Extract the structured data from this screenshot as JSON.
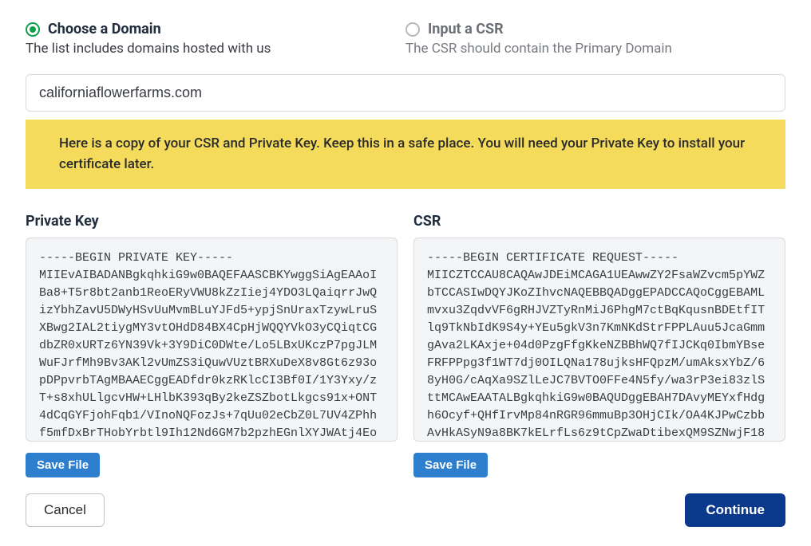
{
  "options": {
    "choose": {
      "label": "Choose a Domain",
      "sub": "The list includes domains hosted with us",
      "selected": true
    },
    "input_csr": {
      "label": "Input a CSR",
      "sub": "The CSR should contain the Primary Domain",
      "selected": false
    }
  },
  "domain": "californiaflowerfarms.com",
  "notice": "Here is a copy of your CSR and Private Key. Keep this in a safe place. You will need your Private Key to install your certificate later.",
  "private_key": {
    "label": "Private Key",
    "content": "-----BEGIN PRIVATE KEY-----\nMIIEvAIBADANBgkqhkiG9w0BAQEFAASCBKYwggSiAgEAAoI\nBa8+T5r8bt2anb1ReoERyVWU8kZzIiej4YDO3LQaiqrrJwQ\nizYbhZavU5DWyHSvUuMvmBLuYJFd5+ypjSnUraxTzywLruS\nXBwg2IAL2tiygMY3vtOHdD84BX4CpHjWQQYVkO3yCQiqtCG\ndbZR0xURTz6YN39Vk+3Y9DiC0DWte/Lo5LBxUKczP7pgJLM\nWuFJrfMh9Bv3AKl2vUmZS3iQuwVUztBRXuDeX8v8Gt6z93o\npDPpvrbTAgMBAAECggEADfdr0kzRKlcCI3Bf0I/1Y3Yxy/z\nT+s8xhULlgcvHW+LHlbK393qBy2keZSZbotLkgcs91x+ONT\n4dCqGYFjohFqb1/VInoNQFozJs+7qUu02eCbZ0L7UV4ZPhh\nf5mfDxBrTHobYrbtl9Ih12Nd6GM7b2pzhEGnlXYJWAtj4Eo",
    "save_label": "Save File"
  },
  "csr": {
    "label": "CSR",
    "content": "-----BEGIN CERTIFICATE REQUEST-----\nMIICZTCCAU8CAQAwJDEiMCAGA1UEAwwZY2FsaWZvcm5pYWZ\nbTCCASIwDQYJKoZIhvcNAQEBBQADggEPADCCAQoCggEBAML\nmvxu3ZqdvVF6gRHJVZTyRnMiJ6PhgM7ctBqKqusnBDEtfIT\nlq9TkNbIdK9S4y+YEu5gkV3n7KmNKdStrFPPLAuu5JcaGmm\ngAva2LKAxje+04d0PzgFfgKkeNZBBhWQ7fIJCKq0IbmYBse\nFRFPPpg3f1WT7dj0OILQNa178ujksHFQpzM/umAksxYbZ/6\n8yH0G/cAqXa9SZlLeJC7BVTO0FFe4N5fy/wa3rP3ei83zlS\nttMCAwEAATALBgkqhkiG9w0BAQUDggEBAH7DAvyMEYxfHdg\nh6Ocyf+QHfIrvMp84nRGR96mmuBp3OHjCIk/OA4KJPwCzbb\nAvHkASyN9a8BK7kELrfLs6z9tCpZwaDtibexQM9SZNwjF18",
    "save_label": "Save File"
  },
  "buttons": {
    "cancel": "Cancel",
    "continue": "Continue"
  }
}
